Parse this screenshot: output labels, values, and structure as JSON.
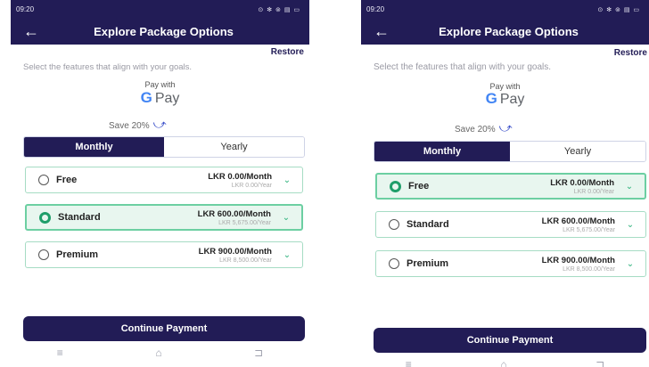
{
  "colors": {
    "primary": "#221c56",
    "accent_green": "#2bb07a",
    "card_border": "#a6dcc4"
  },
  "screens": [
    {
      "status_time": "09:20",
      "status_icons": "⊙ ✻ ⊚ ▤ ▭",
      "app_title": "Explore Package Options",
      "back_icon": "arrow-left-icon",
      "restore_label": "Restore",
      "subtitle": "Select the features that align with your goals.",
      "pay_with": "Pay with",
      "gpay_g": "G",
      "gpay_label": "Pay",
      "save_text": "Save 20%",
      "toggle": {
        "monthly": "Monthly",
        "yearly": "Yearly",
        "selected": "Monthly"
      },
      "plans": [
        {
          "name": "Free",
          "price_month": "LKR 0.00/Month",
          "price_year": "LKR 0.00/Year",
          "selected": false
        },
        {
          "name": "Standard",
          "price_month": "LKR 600.00/Month",
          "price_year": "LKR 5,675.00/Year",
          "selected": true
        },
        {
          "name": "Premium",
          "price_month": "LKR 900.00/Month",
          "price_year": "LKR 8,500.00/Year",
          "selected": false
        }
      ],
      "cta_label": "Continue Payment",
      "nav": [
        "≡",
        "⌂",
        "⊐"
      ]
    },
    {
      "status_time": "09:20",
      "status_icons": "⊙ ✻ ⊚ ▤ ▭",
      "app_title": "Explore Package Options",
      "back_icon": "arrow-left-icon",
      "restore_label": "Restore",
      "subtitle": "Select the features that align with your goals.",
      "pay_with": "Pay with",
      "gpay_g": "G",
      "gpay_label": "Pay",
      "save_text": "Save 20%",
      "toggle": {
        "monthly": "Monthly",
        "yearly": "Yearly",
        "selected": "Monthly"
      },
      "plans": [
        {
          "name": "Free",
          "price_month": "LKR 0.00/Month",
          "price_year": "LKR 0.00/Year",
          "selected": true
        },
        {
          "name": "Standard",
          "price_month": "LKR 600.00/Month",
          "price_year": "LKR 5,675.00/Year",
          "selected": false
        },
        {
          "name": "Premium",
          "price_month": "LKR 900.00/Month",
          "price_year": "LKR 8,500.00/Year",
          "selected": false
        }
      ],
      "cta_label": "Continue Payment",
      "nav": [
        "≡",
        "⌂",
        "⊐"
      ]
    }
  ]
}
